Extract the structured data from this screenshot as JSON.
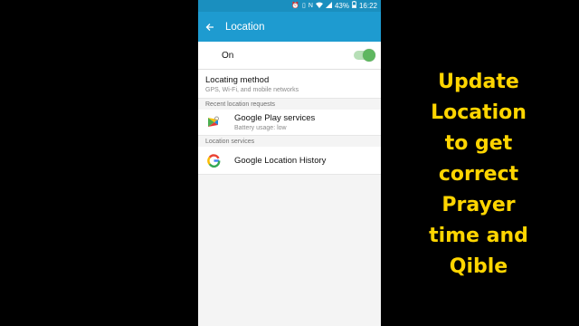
{
  "status_bar": {
    "battery": "43%",
    "time": "16:22",
    "icons": [
      "alarm-icon",
      "vibrate-icon",
      "nfc-icon",
      "wifi-icon",
      "signal-icon",
      "battery-icon"
    ]
  },
  "appbar": {
    "title": "Location",
    "back_icon": "arrow-left-icon"
  },
  "toggle_row": {
    "label": "On",
    "state": true
  },
  "locating_method": {
    "title": "Locating method",
    "subtitle": "GPS, Wi-Fi, and mobile networks"
  },
  "recent_requests": {
    "header": "Recent location requests",
    "items": [
      {
        "title": "Google Play services",
        "subtitle": "Battery usage: low",
        "icon": "google-play-services-icon"
      }
    ]
  },
  "location_services": {
    "header": "Location services",
    "items": [
      {
        "title": "Google Location History",
        "icon": "google-g-icon"
      }
    ]
  },
  "caption": {
    "lines": [
      "Update",
      "Location",
      "to get",
      "correct",
      "Prayer",
      "time and",
      "Qible"
    ]
  },
  "colors": {
    "status_bar": "#1a8fbf",
    "app_bar": "#1e9bd0",
    "toggle_on": "#5fb760",
    "caption": "#ffd500"
  }
}
